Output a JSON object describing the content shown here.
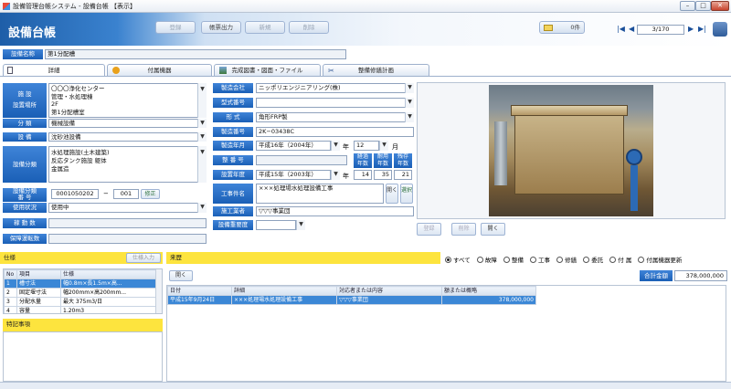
{
  "window": {
    "title": "設備管理台帳システム - 設備台帳 【表示】"
  },
  "header": {
    "title": "設備台帳",
    "buttons": [
      "登録",
      "帳票出力",
      "新規",
      "削除"
    ],
    "count": "0件",
    "page": "3/170"
  },
  "facility_name": {
    "label": "設備名称",
    "value": "第1分配槽"
  },
  "tabs": [
    "詳細",
    "付属機器",
    "完成図書・図面・ファイル",
    "整備修繕計画"
  ],
  "left_form": {
    "location_label": "施 設\n設置場所",
    "location_value": "〇〇〇浄化センター\n管理・水処理棟\n2F\n第1分配槽室",
    "class_label": "分 類",
    "class_value": "機械設備",
    "equip_label": "設 備",
    "equip_value": "沈砂池設備",
    "equip_class_label": "設備分類",
    "equip_class_value": "水処理施設(土木建築)\n反応タンク施設 躯体\n金属造",
    "code_label": "設備分類\n番 号",
    "code_value1": "0001050202",
    "code_sep": "−",
    "code_value2": "001",
    "code_btn": "修正",
    "use_label": "使用状況",
    "use_value": "使用中",
    "run_label": "稼 動 数",
    "run_value": "",
    "maint_label": "保障運転数",
    "maint_value": ""
  },
  "mid_form": {
    "maker_label": "製造会社",
    "maker_value": "ニッポリエンジニアリング(株)",
    "model_label": "型式番号",
    "model_value": "",
    "form_label": "形 式",
    "form_value": "角形FRP製",
    "serial_label": "製造番号",
    "serial_value": "2K−03438C",
    "mfg_year_label": "製造年月",
    "mfg_year_value": "平成16年（2004年）",
    "year_suffix": "年",
    "mfg_month_value": "12",
    "month_suffix": "月",
    "maint_no_label": "整 番 号",
    "maint_no_value": "",
    "years_headers": [
      "経過\n年数",
      "耐用\n年数",
      "残存\n年数"
    ],
    "install_label": "設置年度",
    "install_value": "平成15年（2003年）",
    "years_values": [
      "14",
      "35",
      "21"
    ],
    "work_label": "工事件名",
    "work_value": "×××処理場水処理設備工事",
    "work_btn_open": "開く",
    "work_btn_select": "選択",
    "contractor_label": "施工業者",
    "contractor_value": "▽▽▽事業団",
    "importance_label": "設備重要度",
    "importance_value": ""
  },
  "photo_buttons": [
    "登録",
    "削除",
    "開く"
  ],
  "spec": {
    "title": "仕様",
    "btn": "仕様入力",
    "columns": [
      "No",
      "項目",
      "仕様"
    ],
    "rows": [
      [
        "1",
        "槽寸法",
        "幅0.8m×長1.5m×高..."
      ],
      [
        "2",
        "固定堰寸法",
        "幅200mm×高200mm..."
      ],
      [
        "3",
        "分配水量",
        "最大 375m3/日"
      ],
      [
        "4",
        "容量",
        "1.20m3"
      ]
    ]
  },
  "notes": {
    "title": "特記事項"
  },
  "history": {
    "title": "来歴",
    "filters": [
      "すべて",
      "故障",
      "整備",
      "工事",
      "修繕",
      "委託",
      "付 属",
      "付属機器更新"
    ],
    "open_btn": "開く",
    "total_label": "合計金額",
    "total_value": "378,000,000",
    "columns": [
      "日付",
      "詳細",
      "対応者または内容",
      "額または概略"
    ],
    "rows": [
      [
        "平成15年9月24日",
        "×××処理場水処理設備工事",
        "▽▽▽事業団",
        "378,000,000"
      ]
    ]
  },
  "colors": {
    "accent": "#1a5fb6",
    "selected_row": "#3b87d6",
    "yellow": "#fde43e"
  }
}
